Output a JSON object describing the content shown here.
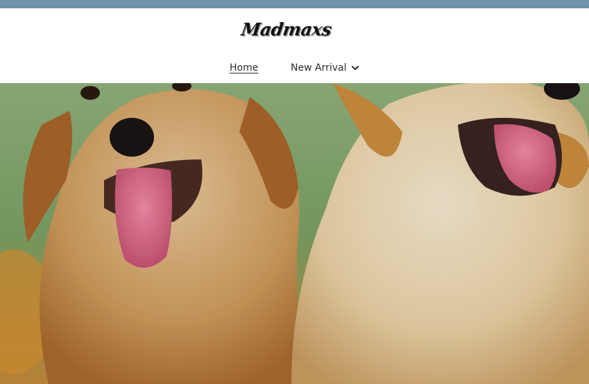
{
  "brand": {
    "logo_text": "Madmaxs"
  },
  "nav": {
    "items": [
      {
        "label": "Home",
        "active": true
      },
      {
        "label": "New Arrival",
        "has_dropdown": true
      }
    ]
  },
  "hero": {
    "image_subject": "two golden retriever puppies"
  },
  "colors": {
    "announcement_bar": "#6f94ab",
    "header_bg": "#ffffff",
    "text": "#2b2b2b"
  }
}
